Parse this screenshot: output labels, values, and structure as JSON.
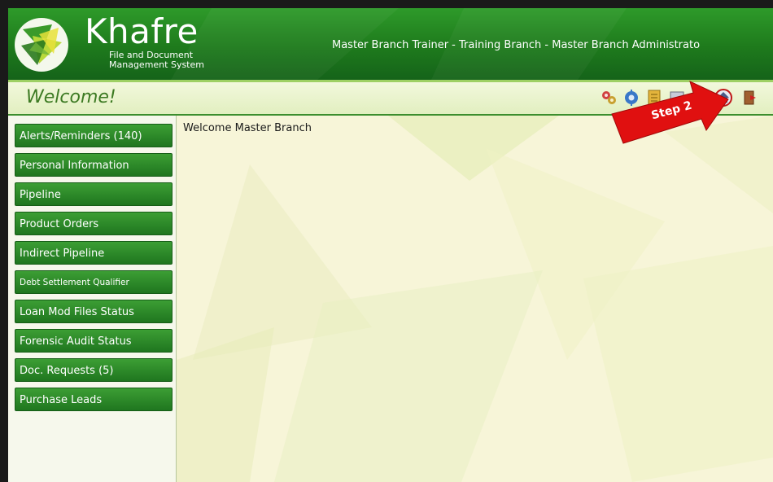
{
  "header": {
    "app_title": "Khafre",
    "subtitle_line1": "File and Document",
    "subtitle_line2": "Management System",
    "user_line": "Master Branch Trainer - Training Branch - Master Branch Administrato"
  },
  "titlebar": {
    "page_title": "Welcome!",
    "toolbar_icons": [
      "gears-icon",
      "gear-icon",
      "document-icon",
      "monitor-icon",
      "home-icon",
      "exit-icon"
    ]
  },
  "sidebar": {
    "items": [
      {
        "label": "Alerts/Reminders (140)"
      },
      {
        "label": "Personal Information"
      },
      {
        "label": "Pipeline"
      },
      {
        "label": "Product Orders"
      },
      {
        "label": "Indirect Pipeline"
      },
      {
        "label": "Debt Settlement Qualifier"
      },
      {
        "label": "Loan Mod Files Status"
      },
      {
        "label": "Forensic Audit Status"
      },
      {
        "label": "Doc. Requests (5)"
      },
      {
        "label": "Purchase Leads"
      }
    ]
  },
  "main": {
    "welcome_text": "Welcome Master Branch"
  },
  "annotation": {
    "step_label": "Step 2"
  },
  "colors": {
    "brand_green": "#1e7a1c",
    "annotation_red": "#e01010"
  }
}
